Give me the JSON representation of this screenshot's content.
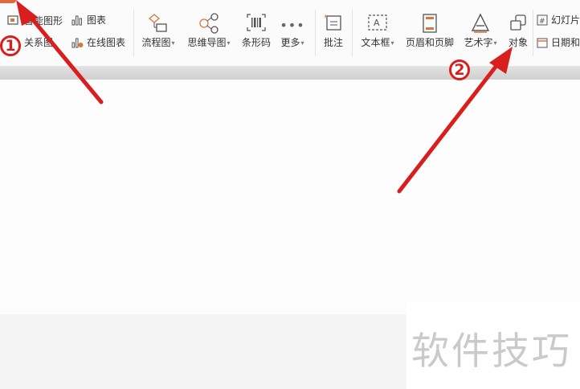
{
  "ribbon": {
    "group_a": {
      "shapes_label": "智能图形",
      "relation_label": "关系图",
      "chart_label": "图表",
      "online_chart_label": "在线图表"
    },
    "flowchart_label": "流程图",
    "mindmap_label": "思维导图",
    "barcode_label": "条形码",
    "more_label": "更多",
    "comment_label": "批注",
    "textbox_label": "文本框",
    "header_footer_label": "页眉和页脚",
    "wordart_label": "艺术字",
    "object_label": "对象",
    "slide_number_label": "幻灯片",
    "date_time_label": "日期和"
  },
  "annotations": {
    "marker_1": "1",
    "marker_2": "2",
    "arrow_color": "#d91e1e"
  },
  "watermark": "软件技巧",
  "colors": {
    "accent": "#e06a3a",
    "icon_stroke": "#555555",
    "icon_accent": "#d9773a"
  }
}
